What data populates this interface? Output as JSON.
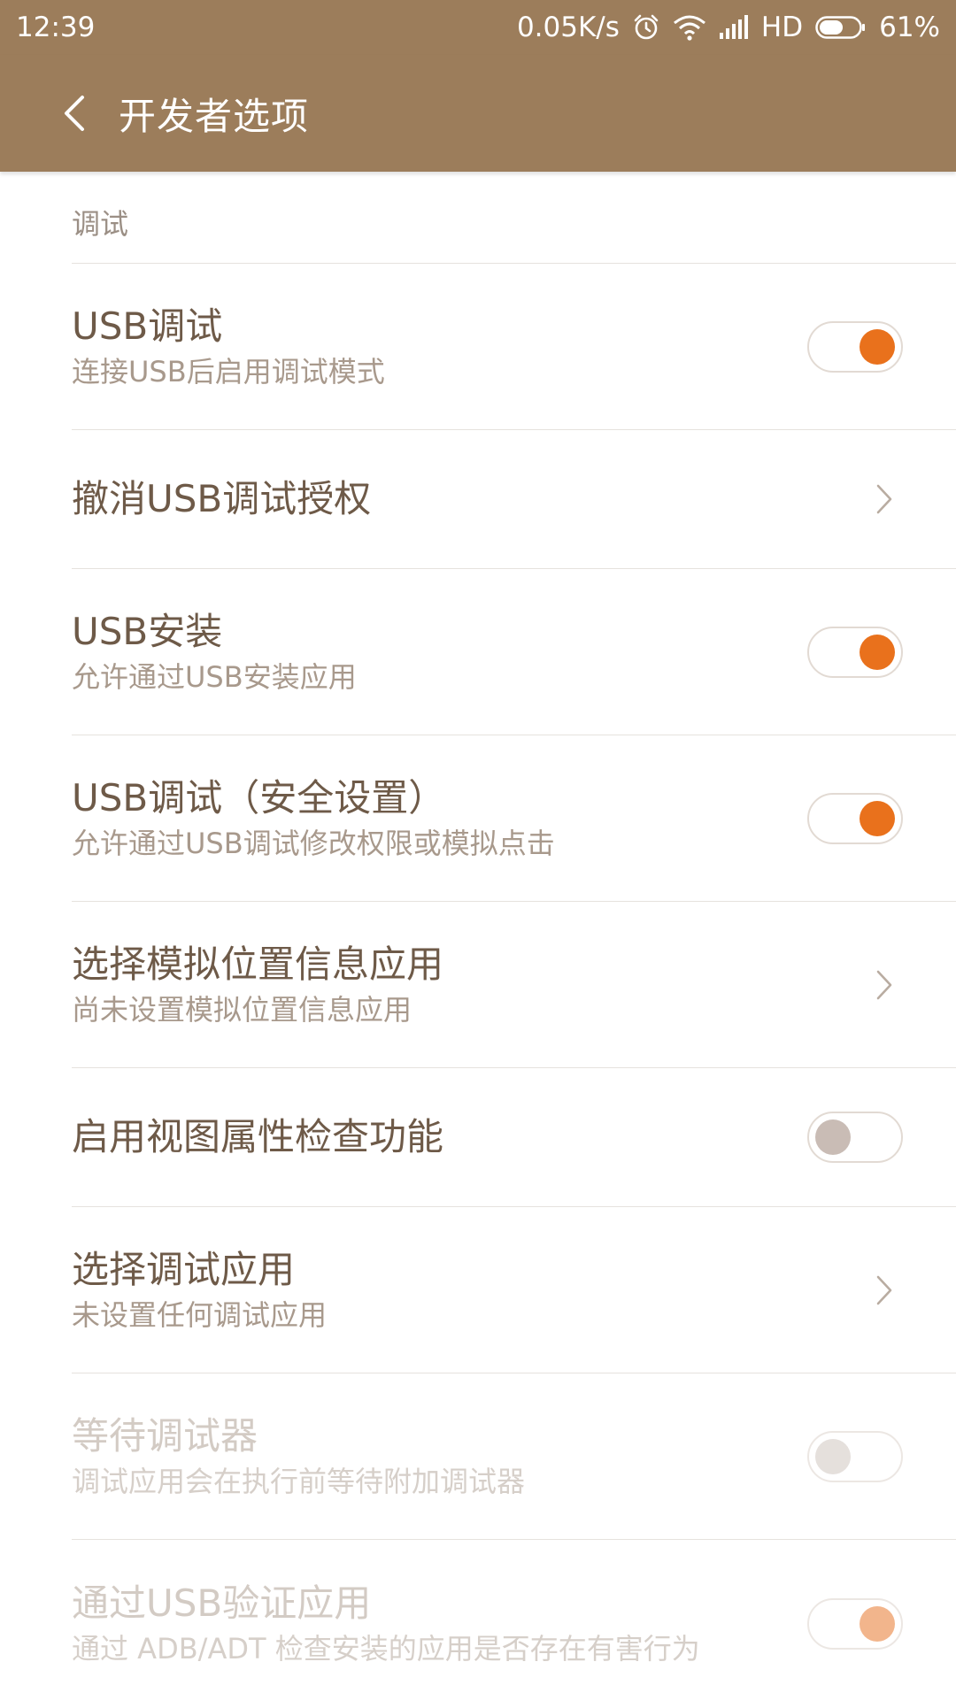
{
  "status_bar": {
    "time": "12:39",
    "net_speed": "0.05K/s",
    "network_type": "HD",
    "battery_percent": "61%",
    "battery_level": 0.61
  },
  "app_bar": {
    "back_icon": "chevron-left-icon",
    "title": "开发者选项"
  },
  "section": {
    "title": "调试"
  },
  "items": [
    {
      "title": "USB调试",
      "summary": "连接USB后启用调试模式",
      "control": "toggle",
      "state": "on",
      "enabled": true
    },
    {
      "title": "撤消USB调试授权",
      "control": "chevron",
      "enabled": true
    },
    {
      "title": "USB安装",
      "summary": "允许通过USB安装应用",
      "control": "toggle",
      "state": "on",
      "enabled": true
    },
    {
      "title": "USB调试（安全设置）",
      "summary": "允许通过USB调试修改权限或模拟点击",
      "control": "toggle",
      "state": "on",
      "enabled": true
    },
    {
      "title": "选择模拟位置信息应用",
      "summary": "尚未设置模拟位置信息应用",
      "control": "chevron",
      "enabled": true
    },
    {
      "title": "启用视图属性检查功能",
      "control": "toggle",
      "state": "off",
      "enabled": true
    },
    {
      "title": "选择调试应用",
      "summary": "未设置任何调试应用",
      "control": "chevron",
      "enabled": true
    },
    {
      "title": "等待调试器",
      "summary": "调试应用会在执行前等待附加调试器",
      "control": "toggle",
      "state": "off",
      "enabled": false
    },
    {
      "title": "通过USB验证应用",
      "summary": "通过 ADB/ADT 检查安装的应用是否存在有害行为",
      "control": "toggle",
      "state": "on",
      "enabled": false
    }
  ],
  "colors": {
    "header_bg": "#9c7d5b",
    "accent": "#e9711c",
    "title_text": "#6e5a48",
    "summary_text": "#a8998c"
  }
}
